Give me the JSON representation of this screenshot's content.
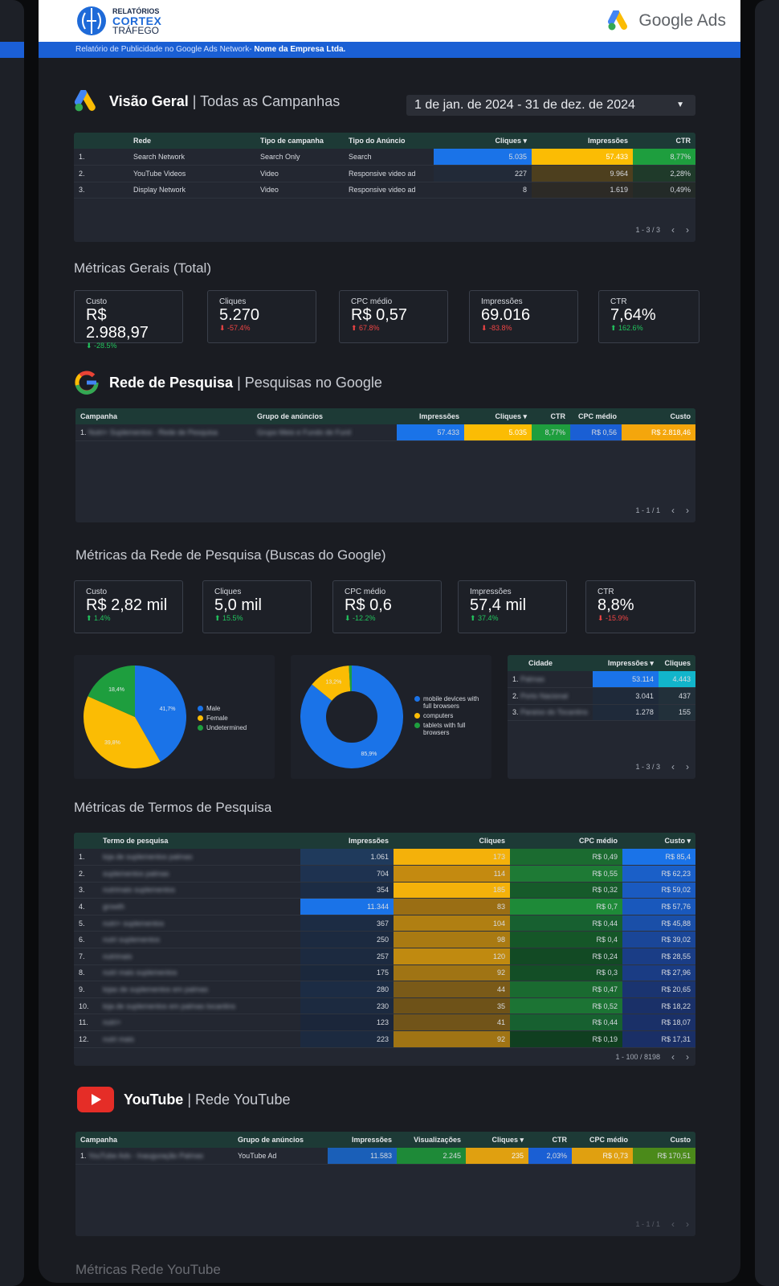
{
  "brand": {
    "line1": "RELATÓRIOS",
    "line2": "CORTEX",
    "line3": "TRÁFEGO",
    "product": "Google Ads"
  },
  "banner": {
    "prefix": "Relatório de Publicidade no Google Ads Network- ",
    "company": "Nome da Empresa Ltda."
  },
  "overview": {
    "title": "Visão Geral",
    "subtitle": "| Todas as Campanhas",
    "date_range": "1 de jan. de 2024 - 31 de dez. de 2024",
    "headers": [
      "Rede",
      "Tipo de campanha",
      "Tipo do Anúncio",
      "Cliques ▾",
      "Impressões",
      "CTR"
    ],
    "rows": [
      {
        "n": "1.",
        "rede": "Search Network",
        "tipo": "Search Only",
        "anuncio": "Search",
        "cliques": "5.035",
        "impressoes": "57.433",
        "ctr": "8,77%"
      },
      {
        "n": "2.",
        "rede": "YouTube Videos",
        "tipo": "Video",
        "anuncio": "Responsive video ad",
        "cliques": "227",
        "impressoes": "9.964",
        "ctr": "2,28%"
      },
      {
        "n": "3.",
        "rede": "Display Network",
        "tipo": "Video",
        "anuncio": "Responsive video ad",
        "cliques": "8",
        "impressoes": "1.619",
        "ctr": "0,49%"
      }
    ],
    "pager": "1 - 3 / 3"
  },
  "general": {
    "title": "Métricas Gerais (Total)",
    "cards": [
      {
        "label": "Custo",
        "value": "R$ 2.988,97",
        "delta": "⬇ -28.5%",
        "dir": "up"
      },
      {
        "label": "Cliques",
        "value": "5.270",
        "delta": "⬇ -57.4%",
        "dir": "down"
      },
      {
        "label": "CPC médio",
        "value": "R$ 0,57",
        "delta": "⬆ 67.8%",
        "dir": "down"
      },
      {
        "label": "Impressões",
        "value": "69.016",
        "delta": "⬇ -83.8%",
        "dir": "down"
      },
      {
        "label": "CTR",
        "value": "7,64%",
        "delta": "⬆ 162.6%",
        "dir": "up"
      }
    ]
  },
  "search": {
    "title": "Rede de Pesquisa",
    "subtitle": "| Pesquisas no Google",
    "headers": [
      "Campanha",
      "Grupo de anúncios",
      "Impressões",
      "Cliques ▾",
      "CTR",
      "CPC médio",
      "Custo"
    ],
    "row": {
      "n": "1.",
      "campanha": "Nutri+ Suplementos - Rede de Pesquisa",
      "grupo": "Grupo Meio e Fundo de Funil",
      "impressoes": "57.433",
      "cliques": "5.035",
      "ctr": "8,77%",
      "cpc": "R$ 0,56",
      "custo": "R$ 2.818,46"
    },
    "pager": "1 - 1 / 1"
  },
  "search_metrics": {
    "title": "Métricas da Rede de Pesquisa (Buscas do Google)",
    "cards": [
      {
        "label": "Custo",
        "value": "R$ 2,82 mil",
        "delta": "⬆ 1.4%",
        "dir": "up"
      },
      {
        "label": "Cliques",
        "value": "5,0 mil",
        "delta": "⬆ 15.5%",
        "dir": "up"
      },
      {
        "label": "CPC médio",
        "value": "R$ 0,6",
        "delta": "⬇ -12.2%",
        "dir": "up"
      },
      {
        "label": "Impressões",
        "value": "57,4 mil",
        "delta": "⬆ 37.4%",
        "dir": "up"
      },
      {
        "label": "CTR",
        "value": "8,8%",
        "delta": "⬇ -15.9%",
        "dir": "down"
      }
    ]
  },
  "gender_pie": {
    "slices": [
      {
        "name": "Male",
        "value": 41.7,
        "color": "#1a73e8"
      },
      {
        "name": "Female",
        "value": 39.8,
        "color": "#fbbc04"
      },
      {
        "name": "Undetermined",
        "value": 18.4,
        "color": "#1e9e3e"
      }
    ],
    "labels": [
      "41,7%",
      "39,8%",
      "18,4%"
    ]
  },
  "device_pie": {
    "slices": [
      {
        "name": "mobile devices with full browsers",
        "value": 85.9,
        "color": "#1a73e8"
      },
      {
        "name": "computers",
        "value": 13.2,
        "color": "#fbbc04"
      },
      {
        "name": "tablets with full browsers",
        "value": 0.9,
        "color": "#1e9e3e"
      }
    ],
    "labels": [
      "85,9%",
      "13,2%"
    ]
  },
  "cities": {
    "headers": [
      "Cidade",
      "Impressões ▾",
      "Cliques"
    ],
    "rows": [
      {
        "n": "1.",
        "city": "Palmas",
        "impressoes": "53.114",
        "cliques": "4.443"
      },
      {
        "n": "2.",
        "city": "Porto Nacional",
        "impressoes": "3.041",
        "cliques": "437"
      },
      {
        "n": "3.",
        "city": "Paraíso do Tocantins",
        "impressoes": "1.278",
        "cliques": "155"
      }
    ],
    "pager": "1 - 3 / 3"
  },
  "terms": {
    "title": "Métricas de Termos de Pesquisa",
    "headers": [
      "Termo de pesquisa",
      "Impressões",
      "Cliques",
      "CPC médio",
      "Custo ▾"
    ],
    "rows": [
      {
        "n": "1.",
        "term": "loja de suplementos palmas",
        "imp": "1.061",
        "cli": "173",
        "cpc": "R$ 0,49",
        "custo": "R$ 85,4"
      },
      {
        "n": "2.",
        "term": "suplementos palmas",
        "imp": "704",
        "cli": "114",
        "cpc": "R$ 0,55",
        "custo": "R$ 62,23"
      },
      {
        "n": "3.",
        "term": "nutrimais suplementos",
        "imp": "354",
        "cli": "185",
        "cpc": "R$ 0,32",
        "custo": "R$ 59,02"
      },
      {
        "n": "4.",
        "term": "growth",
        "imp": "11.344",
        "cli": "83",
        "cpc": "R$ 0,7",
        "custo": "R$ 57,76"
      },
      {
        "n": "5.",
        "term": "nutri+ suplementos",
        "imp": "367",
        "cli": "104",
        "cpc": "R$ 0,44",
        "custo": "R$ 45,88"
      },
      {
        "n": "6.",
        "term": "nutri suplementos",
        "imp": "250",
        "cli": "98",
        "cpc": "R$ 0,4",
        "custo": "R$ 39,02"
      },
      {
        "n": "7.",
        "term": "nutrimais",
        "imp": "257",
        "cli": "120",
        "cpc": "R$ 0,24",
        "custo": "R$ 28,55"
      },
      {
        "n": "8.",
        "term": "nutri mais suplementos",
        "imp": "175",
        "cli": "92",
        "cpc": "R$ 0,3",
        "custo": "R$ 27,96"
      },
      {
        "n": "9.",
        "term": "lojas de suplementos em palmas",
        "imp": "280",
        "cli": "44",
        "cpc": "R$ 0,47",
        "custo": "R$ 20,65"
      },
      {
        "n": "10.",
        "term": "loja de suplementos em palmas tocantins",
        "imp": "230",
        "cli": "35",
        "cpc": "R$ 0,52",
        "custo": "R$ 18,22"
      },
      {
        "n": "11.",
        "term": "nutri+",
        "imp": "123",
        "cli": "41",
        "cpc": "R$ 0,44",
        "custo": "R$ 18,07"
      },
      {
        "n": "12.",
        "term": "nutri mais",
        "imp": "223",
        "cli": "92",
        "cpc": "R$ 0,19",
        "custo": "R$ 17,31"
      }
    ],
    "pager": "1 - 100 / 8198"
  },
  "youtube": {
    "title": "YouTube",
    "subtitle": "| Rede YouTube",
    "headers": [
      "Campanha",
      "Grupo de anúncios",
      "Impressões",
      "Visualizações",
      "Cliques ▾",
      "CTR",
      "CPC médio",
      "Custo"
    ],
    "row": {
      "n": "1.",
      "campanha": "YouTube Ads - Inauguração Palmas",
      "grupo": "YouTube Ad",
      "imp": "11.583",
      "vis": "2.245",
      "cli": "235",
      "ctr": "2,03%",
      "cpc": "R$ 0,73",
      "custo": "R$ 170,51"
    },
    "pager": "1 - 1 / 1",
    "next_title": "Métricas Rede YouTube"
  }
}
